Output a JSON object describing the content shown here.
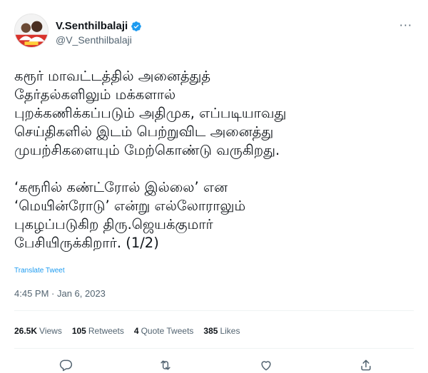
{
  "user": {
    "display_name": "V.Senthilbalaji",
    "handle": "@V_Senthilbalaji",
    "verified": true
  },
  "tweet": {
    "paragraph1": [
      "கரூர் மாவட்டத்தில் அனைத்துத்",
      "தேர்தல்களிலும் மக்களால்",
      "புறக்கணிக்கப்படும் அதிமுக, எப்படியாவது",
      "செய்திகளில் இடம் பெற்றுவிட அனைத்து",
      "முயற்சிகளையும் மேற்கொண்டு வருகிறது."
    ],
    "paragraph2": [
      "‘கரூரில் கண்ட்ரோல் இல்லை’ என",
      "‘மெயின்ரோடு’ என்று எல்லோராலும்",
      "புகழப்படுகிற திரு.ஜெயக்குமார்",
      "பேசியிருக்கிறார். (1/2)"
    ],
    "translate_label": "Translate Tweet",
    "timestamp": "4:45 PM · Jan 6, 2023"
  },
  "stats": {
    "views_count": "26.5K",
    "views_label": "Views",
    "retweets_count": "105",
    "retweets_label": "Retweets",
    "quotes_count": "4",
    "quotes_label": "Quote Tweets",
    "likes_count": "385",
    "likes_label": "Likes"
  },
  "colors": {
    "accent": "#1d9bf0",
    "text": "#0f1419",
    "secondary": "#536471"
  },
  "icons": [
    "more-icon",
    "verified-icon",
    "reply-icon",
    "retweet-icon",
    "like-icon",
    "share-icon"
  ]
}
